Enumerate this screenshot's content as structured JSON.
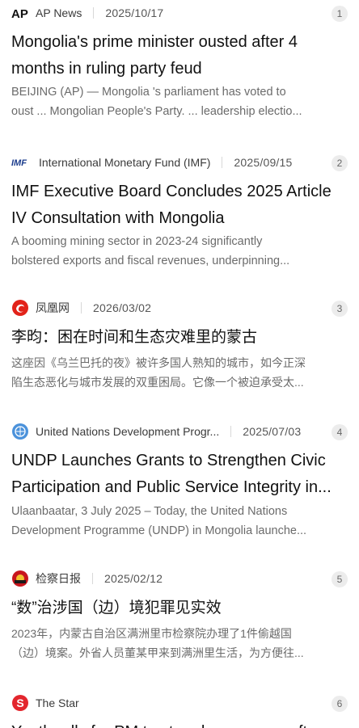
{
  "results": [
    {
      "source": "AP News",
      "icon": "ap-logo",
      "date": "2025/10/17",
      "rank": "1",
      "title": "Mongolia's prime minister ousted after 4 months in ruling party feud",
      "snippet_line1": "BEIJING (AP) — Mongolia 's parliament has voted to",
      "snippet_line2": "oust ... Mongolian People's Party. ... leadership electio..."
    },
    {
      "source": "International Monetary Fund (IMF)",
      "icon": "imf-logo",
      "date": "2025/09/15",
      "rank": "2",
      "title": "IMF Executive Board Concludes 2025 Article IV Consultation with Mongolia",
      "snippet_line1": "A booming mining sector in 2023-24 significantly",
      "snippet_line2": "bolstered exports and fiscal revenues, underpinning..."
    },
    {
      "source": "凤凰网",
      "icon": "ifeng-logo",
      "date": "2026/03/02",
      "rank": "3",
      "title": "李昀：困在时间和生态灾难里的蒙古",
      "snippet_line1": "这座因《乌兰巴托的夜》被许多国人熟知的城市，如今正深",
      "snippet_line2": "陷生态恶化与城市发展的双重困局。它像一个被迫承受太..."
    },
    {
      "source": "United Nations Development Progr...",
      "icon": "un-logo",
      "date": "2025/07/03",
      "rank": "4",
      "title": "UNDP Launches Grants to Strengthen Civic Participation and Public Service Integrity in...",
      "snippet_line1": "Ulaanbaatar, 3 July 2025 – Today, the United Nations",
      "snippet_line2": "Development Programme (UNDP) in Mongolia launche..."
    },
    {
      "source": "检察日报",
      "icon": "jcrb-logo",
      "date": "2025/02/12",
      "rank": "5",
      "title": "“数”治涉国（边）境犯罪见实效",
      "snippet_line1": "2023年，内蒙古自治区满洲里市检察院办理了1件偷越国",
      "snippet_line2": "（边）境案。外省人员董某甲来到满洲里生活，为方便往..."
    },
    {
      "source": "The Star",
      "icon": "the-star-logo",
      "date": "",
      "rank": "6",
      "title": "Youth rally for PM to step down over graft",
      "snippet_line1": "",
      "snippet_line2": ""
    }
  ],
  "colors": {
    "ap": "#111111",
    "imf": "#1b3c8c",
    "ifeng": "#e2231a",
    "un": "#4b92db",
    "jcrb": "#c8161d",
    "star": "#e3262d"
  }
}
